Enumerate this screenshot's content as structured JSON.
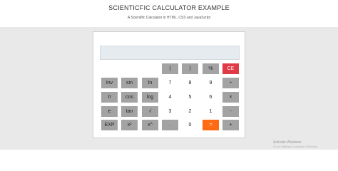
{
  "header": {
    "title": "SCIENTICFIC CALCULATOR EXAMPLE",
    "subtitle": "A Scientific Calculator in HTML, CSS and JavaScript"
  },
  "calculator": {
    "display_value": "",
    "buttons": {
      "open_paren": "(",
      "close_paren": ")",
      "percent": "%",
      "clear": "CE",
      "inv": "Inv",
      "sin": "sin",
      "ln": "ln",
      "seven": "7",
      "eight": "8",
      "nine": "9",
      "divide": "÷",
      "pi": "π",
      "cos": "cos",
      "log": "log",
      "four": "4",
      "five": "5",
      "six": "6",
      "multiply": "×",
      "e": "e",
      "tan": "tan",
      "sqrt": "√",
      "three": "3",
      "two": "2",
      "one": "1",
      "minus": "-",
      "exp": "EXP",
      "square": "x²",
      "power": "x^",
      "dot": ".",
      "zero": "0",
      "equals": "=",
      "plus": "+"
    }
  },
  "watermark": {
    "line1": "Activate Windows",
    "line2": "Go to Settings to activate Windows."
  },
  "colors": {
    "operator_grey": "#a3a3a3",
    "clear_red": "#e03a46",
    "equals_orange": "#ff6a13",
    "display_bg": "#e6ebef"
  }
}
